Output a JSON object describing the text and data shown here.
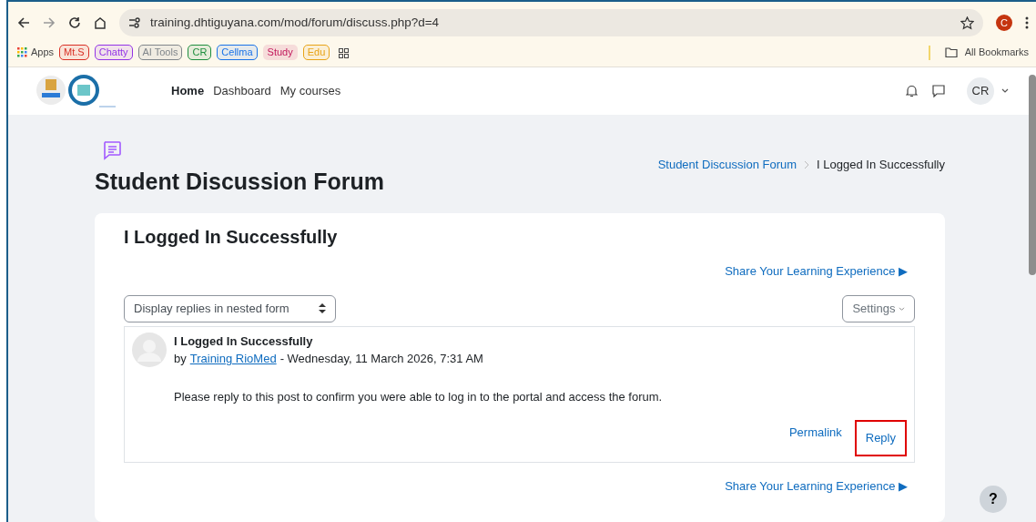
{
  "browser": {
    "url": "training.dhtiguyana.com/mod/forum/discuss.php?d=4",
    "profile": "C",
    "bookmarks": [
      {
        "label": "Apps",
        "kind": "apps"
      },
      {
        "label": "Mt.S",
        "kind": "chip",
        "color": "#d93025"
      },
      {
        "label": "Chatty",
        "kind": "chip",
        "color": "#9334e6"
      },
      {
        "label": "AI Tools",
        "kind": "chip",
        "color": "#80868b"
      },
      {
        "label": "CR",
        "kind": "chip",
        "color": "#1e8e3e"
      },
      {
        "label": "Cellma",
        "kind": "chip",
        "color": "#1a73e8"
      },
      {
        "label": "Study",
        "kind": "fill",
        "color": "#c2185b"
      },
      {
        "label": "Edu",
        "kind": "chip",
        "color": "#e8a317"
      }
    ],
    "all_bookmarks": "All Bookmarks"
  },
  "navbar": {
    "items": [
      {
        "label": "Home",
        "selected": true
      },
      {
        "label": "Dashboard",
        "selected": false
      },
      {
        "label": "My courses",
        "selected": false
      }
    ],
    "avatar": "CR"
  },
  "page": {
    "heading": "Student Discussion Forum",
    "breadcrumb": [
      {
        "label": "Student Discussion Forum",
        "kind": "link"
      },
      {
        "label": "I Logged In Successfully",
        "kind": "current"
      }
    ]
  },
  "discussion": {
    "title": "I Logged In Successfully",
    "share_top": "Share Your Learning Experience ▶",
    "display_mode": "Display replies in nested form",
    "settings": "Settings",
    "post": {
      "subject": "I Logged In Successfully",
      "by": "by",
      "author": "Training RioMed",
      "date": "- Wednesday, 11 March 2026, 7:31 AM",
      "message": "Please reply to this post to confirm you were able to log in to the portal and access the forum.",
      "actions": [
        {
          "label": "Permalink",
          "highlighted": false
        },
        {
          "label": "Reply",
          "highlighted": true
        }
      ]
    },
    "share_bottom": "Share Your Learning Experience ▶"
  },
  "help": "?"
}
